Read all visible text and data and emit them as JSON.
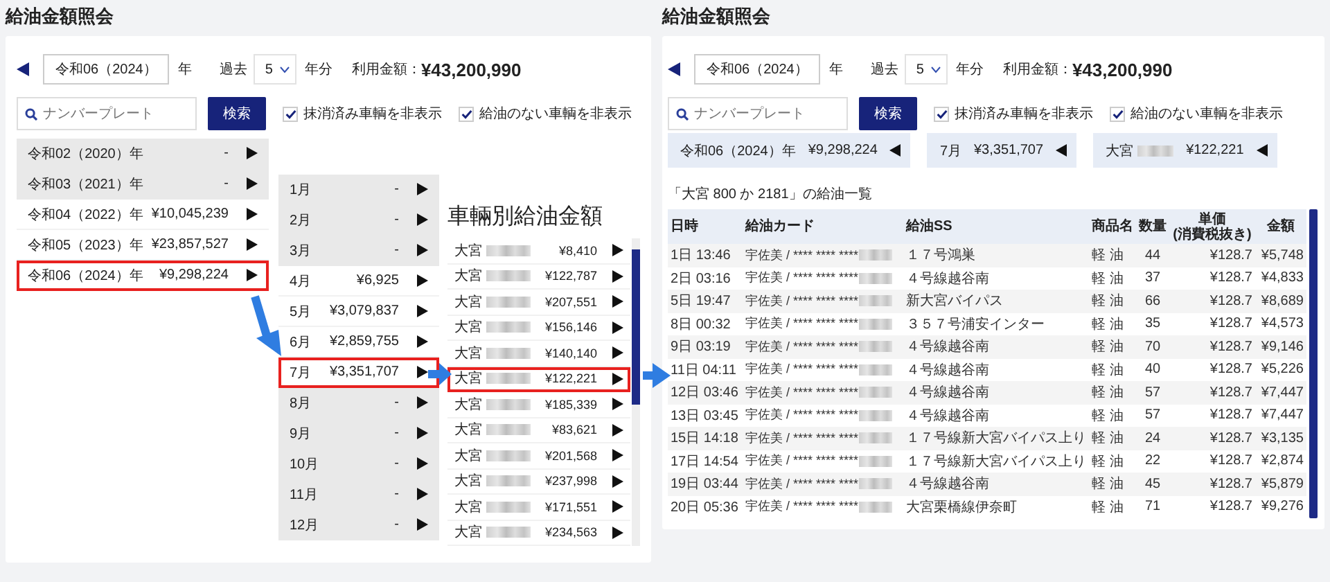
{
  "left": {
    "title": "給油金額照会",
    "toolbar": {
      "year_value": "令和06（2024）",
      "year_unit": "年",
      "past_label": "過去",
      "past_value": "5",
      "past_unit": "年分",
      "total_label": "利用金額：",
      "total_value": "¥43,200,990",
      "search": {
        "placeholder": "ナンバープレート"
      },
      "search_button": "検索",
      "filters": [
        {
          "label": "抹消済み車輌を非表示",
          "checked": true
        },
        {
          "label": "給油のない車輌を非表示",
          "checked": true
        }
      ]
    },
    "years": [
      {
        "label": "令和02（2020）年",
        "amount": "-",
        "disabled": true,
        "selected": false
      },
      {
        "label": "令和03（2021）年",
        "amount": "-",
        "disabled": true,
        "selected": false
      },
      {
        "label": "令和04（2022）年",
        "amount": "¥10,045,239",
        "disabled": false,
        "selected": false
      },
      {
        "label": "令和05（2023）年",
        "amount": "¥23,857,527",
        "disabled": false,
        "selected": false
      },
      {
        "label": "令和06（2024）年",
        "amount": "¥9,298,224",
        "disabled": false,
        "selected": true
      }
    ],
    "months": [
      {
        "label": "1月",
        "amount": "-",
        "disabled": true,
        "selected": false
      },
      {
        "label": "2月",
        "amount": "-",
        "disabled": true,
        "selected": false
      },
      {
        "label": "3月",
        "amount": "-",
        "disabled": true,
        "selected": false
      },
      {
        "label": "4月",
        "amount": "¥6,925",
        "disabled": false,
        "selected": false
      },
      {
        "label": "5月",
        "amount": "¥3,079,837",
        "disabled": false,
        "selected": false
      },
      {
        "label": "6月",
        "amount": "¥2,859,755",
        "disabled": false,
        "selected": false
      },
      {
        "label": "7月",
        "amount": "¥3,351,707",
        "disabled": false,
        "selected": true
      },
      {
        "label": "8月",
        "amount": "-",
        "disabled": true,
        "selected": false
      },
      {
        "label": "9月",
        "amount": "-",
        "disabled": true,
        "selected": false
      },
      {
        "label": "10月",
        "amount": "-",
        "disabled": true,
        "selected": false
      },
      {
        "label": "11月",
        "amount": "-",
        "disabled": true,
        "selected": false
      },
      {
        "label": "12月",
        "amount": "-",
        "disabled": true,
        "selected": false
      }
    ],
    "vehicles_heading": "車輛別給油金額",
    "vehicles": [
      {
        "label": "大宮",
        "amount": "¥8,410",
        "redacted": true,
        "selected": false
      },
      {
        "label": "大宮",
        "amount": "¥122,787",
        "redacted": true,
        "selected": false
      },
      {
        "label": "大宮",
        "amount": "¥207,551",
        "redacted": true,
        "selected": false
      },
      {
        "label": "大宮",
        "amount": "¥156,146",
        "redacted": true,
        "selected": false
      },
      {
        "label": "大宮",
        "amount": "¥140,140",
        "redacted": true,
        "selected": false
      },
      {
        "label": "大宮",
        "amount": "¥122,221",
        "redacted": true,
        "selected": true
      },
      {
        "label": "大宮",
        "amount": "¥185,339",
        "redacted": true,
        "selected": false
      },
      {
        "label": "大宮",
        "amount": "¥83,621",
        "redacted": true,
        "selected": false
      },
      {
        "label": "大宮",
        "amount": "¥201,568",
        "redacted": true,
        "selected": false
      },
      {
        "label": "大宮",
        "amount": "¥237,998",
        "redacted": true,
        "selected": false
      },
      {
        "label": "大宮",
        "amount": "¥171,551",
        "redacted": true,
        "selected": false
      },
      {
        "label": "大宮",
        "amount": "¥234,563",
        "redacted": true,
        "selected": false
      }
    ]
  },
  "right": {
    "title": "給油金額照会",
    "toolbar": {
      "year_value": "令和06（2024）",
      "year_unit": "年",
      "past_label": "過去",
      "past_value": "5",
      "past_unit": "年分",
      "total_label": "利用金額：",
      "total_value": "¥43,200,990",
      "search": {
        "placeholder": "ナンバープレート"
      },
      "search_button": "検索",
      "filters": [
        {
          "label": "抹消済み車輌を非表示",
          "checked": true
        },
        {
          "label": "給油のない車輌を非表示",
          "checked": true
        }
      ]
    },
    "breadcrumbs": [
      {
        "label": "令和06（2024）年",
        "amount": "¥9,298,224",
        "redacted": false
      },
      {
        "label": "7月",
        "amount": "¥3,351,707",
        "redacted": false
      },
      {
        "label": "大宮",
        "amount": "¥122,221",
        "redacted": true
      }
    ],
    "caption": "「大宮 800 か 2181」の給油一覧",
    "table": {
      "columns": [
        {
          "label": "日時",
          "kind": "text"
        },
        {
          "label": "給油カード",
          "kind": "redacted"
        },
        {
          "label": "給油SS",
          "kind": "text"
        },
        {
          "label": "商品名",
          "kind": "text"
        },
        {
          "label": "数量",
          "kind": "center"
        },
        {
          "label": "単価\n(消費税抜き)",
          "kind": "number"
        },
        {
          "label": "金額",
          "kind": "number"
        }
      ],
      "rows": [
        [
          "1日 13:46",
          "宇佐美 / **** **** ****",
          "１７号鴻巣",
          "軽 油",
          "44",
          "¥128.7",
          "¥5,748"
        ],
        [
          "2日 03:16",
          "宇佐美 / **** **** ****",
          "４号線越谷南",
          "軽 油",
          "37",
          "¥128.7",
          "¥4,833"
        ],
        [
          "5日 19:47",
          "宇佐美 / **** **** ****",
          "新大宮バイパス",
          "軽 油",
          "66",
          "¥128.7",
          "¥8,689"
        ],
        [
          "8日 00:32",
          "宇佐美 / **** **** ****",
          "３５７号浦安インター",
          "軽 油",
          "35",
          "¥128.7",
          "¥4,573"
        ],
        [
          "9日 03:19",
          "宇佐美 / **** **** ****",
          "４号線越谷南",
          "軽 油",
          "70",
          "¥128.7",
          "¥9,146"
        ],
        [
          "11日 04:11",
          "宇佐美 / **** **** ****",
          "４号線越谷南",
          "軽 油",
          "40",
          "¥128.7",
          "¥5,226"
        ],
        [
          "12日 03:46",
          "宇佐美 / **** **** ****",
          "４号線越谷南",
          "軽 油",
          "57",
          "¥128.7",
          "¥7,447"
        ],
        [
          "13日 03:45",
          "宇佐美 / **** **** ****",
          "４号線越谷南",
          "軽 油",
          "57",
          "¥128.7",
          "¥7,447"
        ],
        [
          "15日 14:18",
          "宇佐美 / **** **** ****",
          "１７号線新大宮バイパス上り",
          "軽 油",
          "24",
          "¥128.7",
          "¥3,135"
        ],
        [
          "17日 14:54",
          "宇佐美 / **** **** ****",
          "１７号線新大宮バイパス上り",
          "軽 油",
          "22",
          "¥128.7",
          "¥2,874"
        ],
        [
          "19日 03:44",
          "宇佐美 / **** **** ****",
          "４号線越谷南",
          "軽 油",
          "45",
          "¥128.7",
          "¥5,879"
        ],
        [
          "20日 05:36",
          "宇佐美 / **** **** ****",
          "大宮栗橋線伊奈町",
          "軽 油",
          "71",
          "¥128.7",
          "¥9,276"
        ]
      ]
    }
  }
}
